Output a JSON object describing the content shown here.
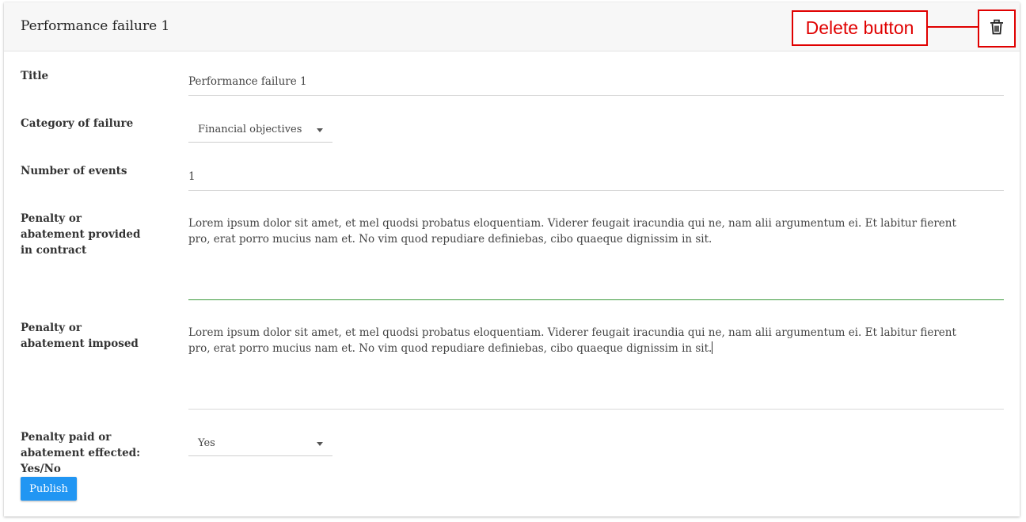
{
  "header": {
    "title": "Performance failure 1",
    "annotation": "Delete button",
    "delete_icon": "trash-icon",
    "annotation_color": "#e00000"
  },
  "form": {
    "title_label": "Title",
    "title_value": "Performance failure 1",
    "category_label": "Category of failure",
    "category_value": "Financial objectives",
    "events_label": "Number of events",
    "events_value": "1",
    "penalty_contract_label": "Penalty or abatement provided in contract",
    "penalty_contract_value": "Lorem ipsum dolor sit amet, et mel quodsi probatus eloquentiam. Viderer feugait iracundia qui ne, nam alii argumentum ei. Et labitur fierent pro, erat porro mucius nam et. No vim quod repudiare definiebas, cibo quaeque dignissim in sit.",
    "penalty_imposed_label": "Penalty or abatement imposed",
    "penalty_imposed_value": "Lorem ipsum dolor sit amet, et mel quodsi probatus eloquentiam. Viderer feugait iracundia qui ne, nam alii argumentum ei. Et labitur fierent pro, erat porro mucius nam et. No vim quod repudiare definiebas, cibo quaeque dignissim in sit.",
    "penalty_paid_label": "Penalty paid or abatement effected: Yes/No",
    "penalty_paid_value": "Yes"
  },
  "actions": {
    "publish_label": "Publish",
    "publish_color": "#2196f3"
  },
  "colors": {
    "active_underline": "#3c9a3c"
  }
}
